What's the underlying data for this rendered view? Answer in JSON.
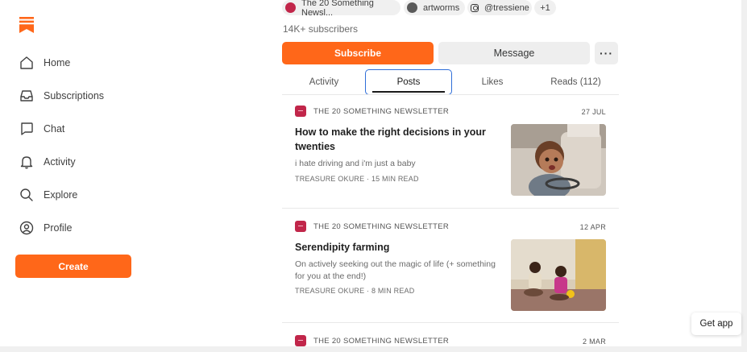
{
  "sidebar": {
    "items": [
      {
        "label": "Home",
        "icon": "home-icon"
      },
      {
        "label": "Subscriptions",
        "icon": "inbox-icon"
      },
      {
        "label": "Chat",
        "icon": "chat-icon"
      },
      {
        "label": "Activity",
        "icon": "bell-icon"
      },
      {
        "label": "Explore",
        "icon": "search-icon"
      },
      {
        "label": "Profile",
        "icon": "profile-icon"
      }
    ],
    "create_label": "Create"
  },
  "profile": {
    "chips": [
      {
        "label": "The 20 Something Newsl...",
        "icon": "publication-avatar"
      },
      {
        "label": "artworms",
        "icon": "artworms-avatar"
      },
      {
        "label": "@tressiene",
        "icon": "instagram-icon"
      },
      {
        "label": "+1"
      }
    ],
    "subscribers": "14K+ subscribers",
    "subscribe_label": "Subscribe",
    "message_label": "Message",
    "more_label": "···"
  },
  "tabs": [
    {
      "label": "Activity",
      "active": false
    },
    {
      "label": "Posts",
      "active": true
    },
    {
      "label": "Likes",
      "active": false
    },
    {
      "label": "Reads (112)",
      "active": false
    }
  ],
  "posts": [
    {
      "publication": "THE 20 SOMETHING NEWSLETTER",
      "date": "27 JUL",
      "title": "How to make the right decisions in your twenties",
      "subtitle": "i hate driving and i'm just a baby",
      "author": "TREASURE OKURE",
      "read_time": "15 MIN READ"
    },
    {
      "publication": "THE 20 SOMETHING NEWSLETTER",
      "date": "12 APR",
      "title": "Serendipity farming",
      "subtitle": "On actively seeking out the magic of life (+ something for you at the end!)",
      "author": "TREASURE OKURE",
      "read_time": "8 MIN READ"
    },
    {
      "publication": "THE 20 SOMETHING NEWSLETTER",
      "date": "2 MAR"
    }
  ],
  "meta_separator": "·",
  "get_app_label": "Get app",
  "colors": {
    "accent": "#ff6719",
    "publication": "#c1264a",
    "tab_focus": "#2f6ed8"
  }
}
